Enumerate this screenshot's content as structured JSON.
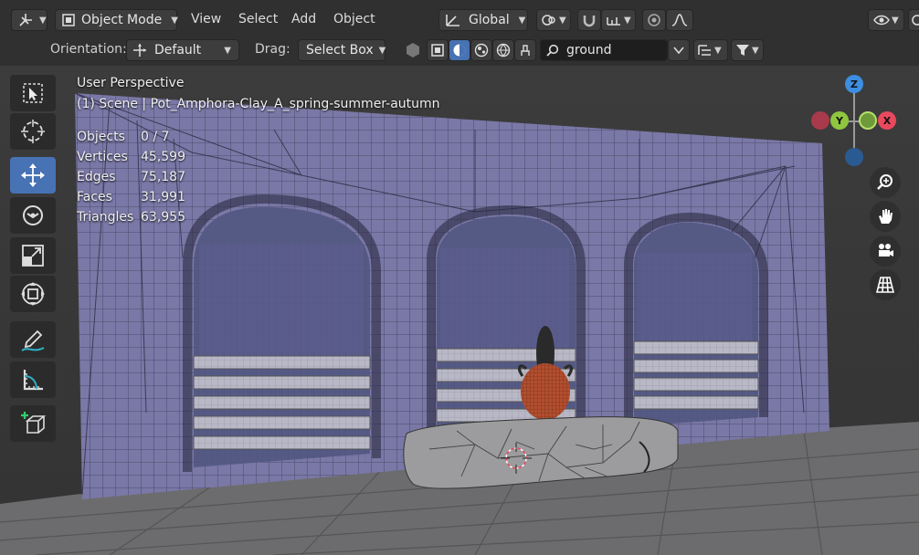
{
  "header": {
    "editor_type_icon": "axis-gizmo-icon",
    "mode": "Object Mode",
    "menus": [
      "View",
      "Select",
      "Add",
      "Object"
    ],
    "transform_orientation": "Global",
    "orientation_label": "Orientation:",
    "orientation_value": "Default",
    "drag_label": "Drag:",
    "drag_value": "Select Box",
    "search_value": "ground"
  },
  "viewport": {
    "title": "User Perspective",
    "scene_line": "(1) Scene | Pot_Amphora-Clay_A_spring-summer-autumn",
    "stats": [
      {
        "label": "Objects",
        "value": "0 / 7"
      },
      {
        "label": "Vertices",
        "value": "45,599"
      },
      {
        "label": "Edges",
        "value": "75,187"
      },
      {
        "label": "Faces",
        "value": "31,991"
      },
      {
        "label": "Triangles",
        "value": "63,955"
      }
    ],
    "gizmo": {
      "z": "Z",
      "y": "Y",
      "x": "X"
    }
  },
  "colors": {
    "accent": "#4772b3",
    "wall": "#7a78a6",
    "axis_x": "#e8495d",
    "axis_y": "#8ec63f",
    "axis_z": "#3d8ee0"
  },
  "tools": [
    "select-box",
    "cursor",
    "move",
    "rotate",
    "scale",
    "transform",
    "annotate",
    "measure",
    "add-cube"
  ]
}
